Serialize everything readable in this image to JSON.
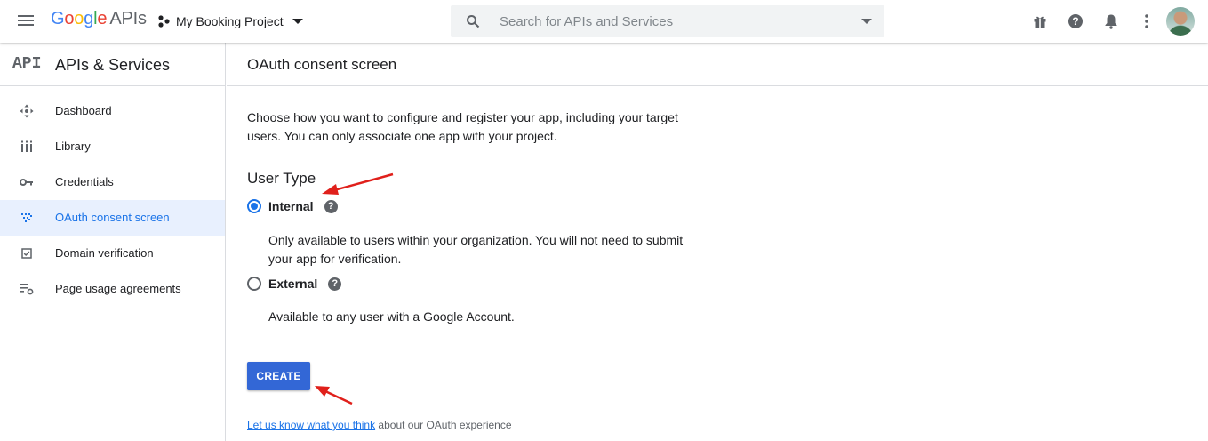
{
  "header": {
    "brand_google": "Google",
    "brand_apis": "APIs",
    "project_name": "My Booking Project",
    "search_placeholder": "Search for APIs and Services"
  },
  "top_icons": [
    "gift-icon",
    "help-icon",
    "notifications-icon",
    "more-vert-icon",
    "avatar"
  ],
  "sidebar": {
    "logo": "API",
    "title": "APIs & Services",
    "items": [
      {
        "label": "Dashboard",
        "icon": "dashboard-icon",
        "active": false
      },
      {
        "label": "Library",
        "icon": "library-icon",
        "active": false
      },
      {
        "label": "Credentials",
        "icon": "key-icon",
        "active": false
      },
      {
        "label": "OAuth consent screen",
        "icon": "consent-icon",
        "active": true
      },
      {
        "label": "Domain verification",
        "icon": "checkbox-icon",
        "active": false
      },
      {
        "label": "Page usage agreements",
        "icon": "settings-list-icon",
        "active": false
      }
    ]
  },
  "main": {
    "title": "OAuth consent screen",
    "intro": "Choose how you want to configure and register your app, including your target users. You can only associate one app with your project.",
    "user_type_heading": "User Type",
    "options": [
      {
        "label": "Internal",
        "selected": true,
        "description": "Only available to users within your organization. You will not need to submit your app for verification."
      },
      {
        "label": "External",
        "selected": false,
        "description": "Available to any user with a Google Account."
      }
    ],
    "help_glyph": "?",
    "create_label": "CREATE",
    "feedback_link": "Let us know what you think",
    "feedback_rest": " about our OAuth experience"
  },
  "colors": {
    "primary": "#1a73e8",
    "button": "#3367d6",
    "active_bg": "#e8f0fe",
    "annotation_arrow": "#e0201b"
  }
}
